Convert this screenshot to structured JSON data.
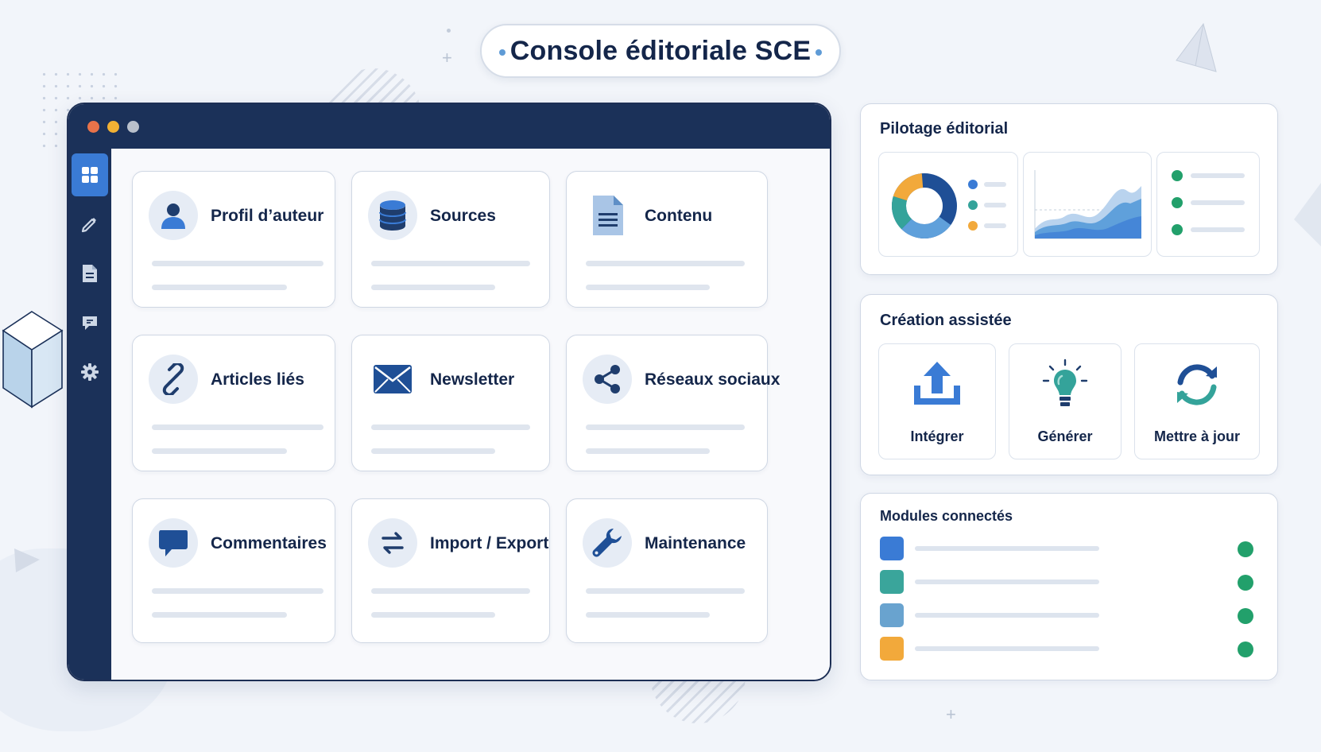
{
  "page": {
    "title": "Console éditoriale SCE"
  },
  "window": {
    "traffic_lights": [
      "#e8734a",
      "#f2b134",
      "#b9c0cb"
    ],
    "sidebar": [
      {
        "icon": "grid-icon",
        "active": true
      },
      {
        "icon": "pencil-icon",
        "active": false
      },
      {
        "icon": "document-icon",
        "active": false
      },
      {
        "icon": "comment-icon",
        "active": false
      },
      {
        "icon": "gear-icon",
        "active": false
      }
    ],
    "cards": [
      {
        "label": "Profil d’auteur",
        "icon": "user-icon"
      },
      {
        "label": "Sources",
        "icon": "database-icon"
      },
      {
        "label": "Contenu",
        "icon": "file-text-icon"
      },
      {
        "label": "Articles liés",
        "icon": "link-icon"
      },
      {
        "label": "Newsletter",
        "icon": "envelope-icon"
      },
      {
        "label": "Réseaux sociaux",
        "icon": "share-icon"
      },
      {
        "label": "Commentaires",
        "icon": "speech-bubble-icon"
      },
      {
        "label": "Import / Export",
        "icon": "swap-arrows-icon"
      },
      {
        "label": "Maintenance",
        "icon": "wrench-icon"
      }
    ]
  },
  "panels": {
    "pilotage": {
      "title": "Pilotage éditorial",
      "legend_colors": [
        "#3a7bd5",
        "#34a39a",
        "#f2a93b"
      ]
    },
    "creation": {
      "title": "Création assistée",
      "actions": [
        {
          "label": "Intégrer",
          "icon": "upload-icon"
        },
        {
          "label": "Générer",
          "icon": "lightbulb-icon"
        },
        {
          "label": "Mettre à jour",
          "icon": "refresh-icon"
        }
      ]
    },
    "modules": {
      "title": "Modules connectés",
      "items": [
        {
          "color": "#3a7bd5",
          "status_color": "#22a06b"
        },
        {
          "color": "#3aa59b",
          "status_color": "#22a06b"
        },
        {
          "color": "#69a3cf",
          "status_color": "#22a06b"
        },
        {
          "color": "#f2a93b",
          "status_color": "#22a06b"
        }
      ]
    }
  }
}
